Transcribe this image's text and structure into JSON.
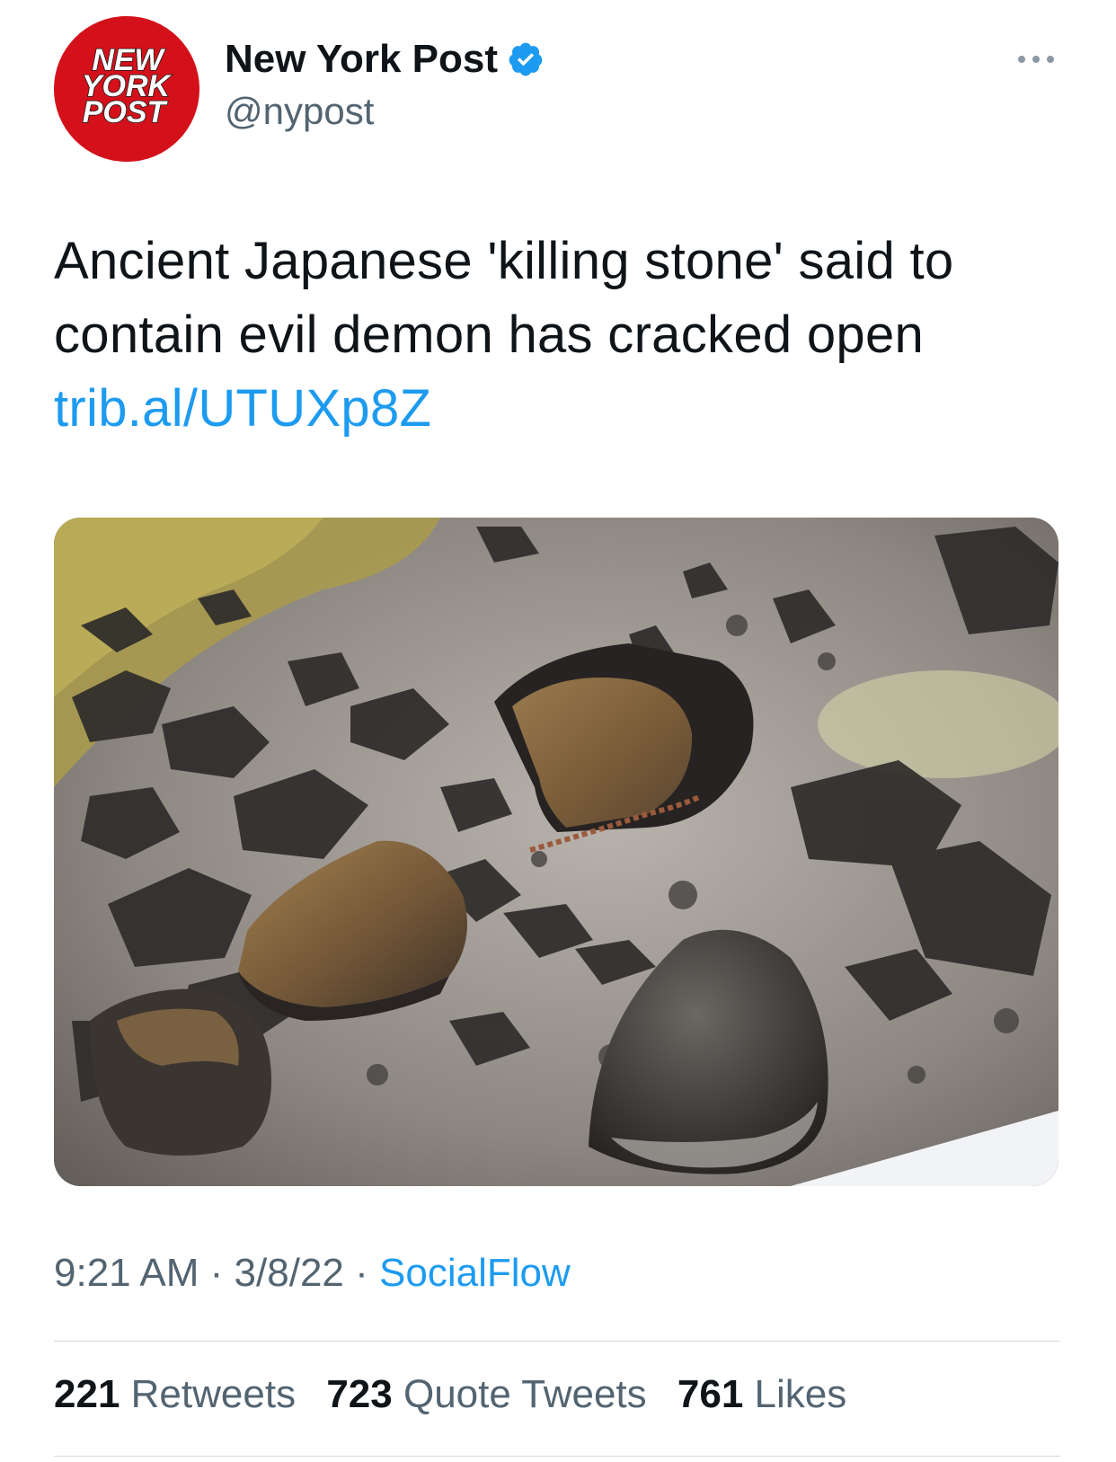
{
  "author": {
    "display_name": "New York Post",
    "handle": "@nypost",
    "verified": true,
    "avatar_logo_text": [
      "NEW",
      "YORK",
      "POST"
    ],
    "avatar_color": "#d4111b"
  },
  "tweet": {
    "text": "Ancient Japanese 'killing stone' said to contain evil demon has cracked open",
    "link": "trib.al/UTUXp8Z",
    "media_alt": "Photo of a broken boulder split into two halves amid dark volcanic rocks on a grey hillside"
  },
  "meta": {
    "time": "9:21 AM",
    "separator": " · ",
    "date": "3/8/22",
    "source": "SocialFlow"
  },
  "stats": {
    "retweets_count": "221",
    "retweets_label": "Retweets",
    "quote_tweets_count": "723",
    "quote_tweets_label": "Quote Tweets",
    "likes_count": "761",
    "likes_label": "Likes"
  },
  "colors": {
    "link": "#1d9bf0",
    "secondary_text": "#536471",
    "primary_text": "#0f1419",
    "verified_badge": "#1d9bf0"
  },
  "icons": {
    "verified": "verified-badge-icon",
    "more": "more-options-icon"
  }
}
